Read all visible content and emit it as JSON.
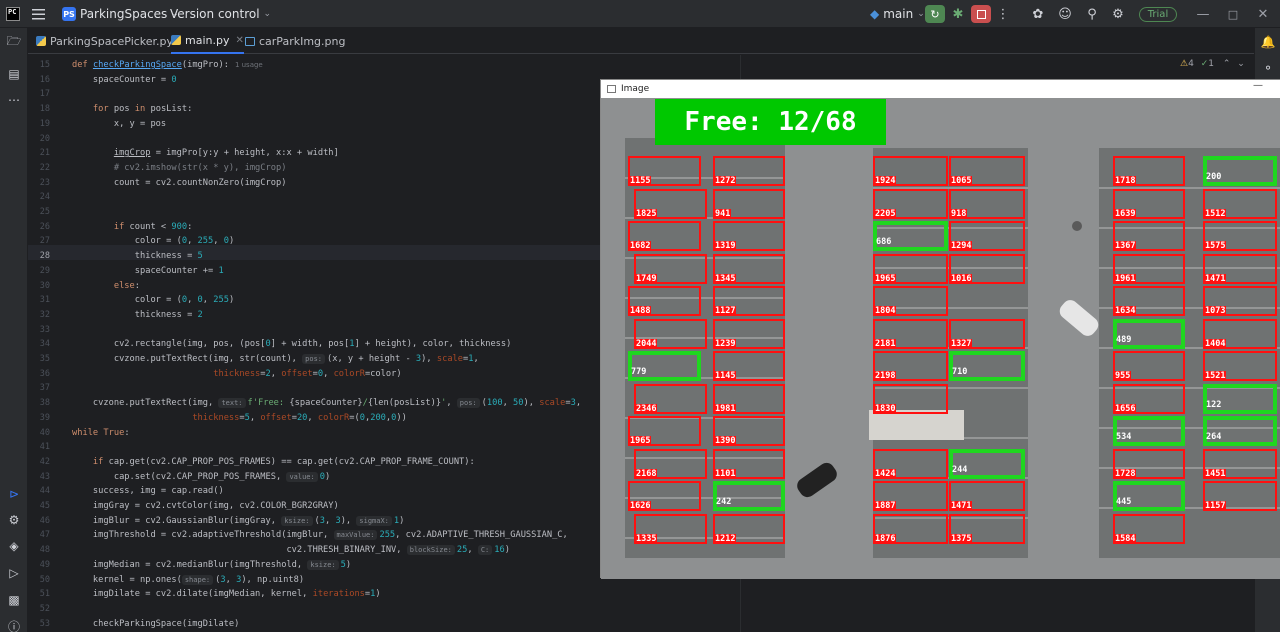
{
  "titlebar": {
    "project_badge": "PS",
    "project_name": "ParkingSpaces",
    "vcs_label": "Version control",
    "run_config": "main",
    "trial_label": "Trial"
  },
  "tabs": [
    {
      "label": "ParkingSpacePicker.py",
      "kind": "py"
    },
    {
      "label": "main.py",
      "kind": "py"
    },
    {
      "label": "carParkImg.png",
      "kind": "png"
    }
  ],
  "editor": {
    "current_line": 28,
    "warnings": "4",
    "weak_warnings": "1",
    "lines": [
      {
        "n": 15,
        "html": "<span class='kw'>def</span> <span class='fn'>checkParkingSpace</span>(imgPro):<span class='hint-usage'>1 usage</span>"
      },
      {
        "n": 16,
        "html": "    spaceCounter = <span class='num'>0</span>"
      },
      {
        "n": 17,
        "html": ""
      },
      {
        "n": 18,
        "html": "    <span class='kw'>for</span> pos <span class='kw'>in</span> posList:"
      },
      {
        "n": 19,
        "html": "        x, y = pos"
      },
      {
        "n": 20,
        "html": ""
      },
      {
        "n": 21,
        "html": "        <span style='text-decoration:underline'>imgCrop</span> = imgPro[y:y + height, x:x + width]"
      },
      {
        "n": 22,
        "html": "        <span class='cm'># cv2.imshow(str(x * y), imgCrop)</span>"
      },
      {
        "n": 23,
        "html": "        count = cv2.countNonZero(imgCrop)"
      },
      {
        "n": 24,
        "html": ""
      },
      {
        "n": 25,
        "html": ""
      },
      {
        "n": 26,
        "html": "        <span class='kw'>if</span> count &lt; <span class='num'>900</span>:"
      },
      {
        "n": 27,
        "html": "            color = (<span class='num'>0</span>, <span class='num'>255</span>, <span class='num'>0</span>)"
      },
      {
        "n": 28,
        "html": "            thickness = <span class='num'>5</span>"
      },
      {
        "n": 29,
        "html": "            spaceCounter += <span class='num'>1</span>"
      },
      {
        "n": 30,
        "html": "        <span class='kw'>else</span>:"
      },
      {
        "n": 31,
        "html": "            color = (<span class='num'>0</span>, <span class='num'>0</span>, <span class='num'>255</span>)"
      },
      {
        "n": 32,
        "html": "            thickness = <span class='num'>2</span>"
      },
      {
        "n": 33,
        "html": ""
      },
      {
        "n": 34,
        "html": "        cv2.rectangle(img, pos, (pos[<span class='num'>0</span>] + width, pos[<span class='num'>1</span>] + height), color, thickness)"
      },
      {
        "n": 35,
        "html": "        cvzone.putTextRect(img, str(count), <span class='hint'>pos:</span>(x, y + height - <span class='num'>3</span>), <span class='kwarg'>scale</span>=<span class='num'>1</span>,"
      },
      {
        "n": 36,
        "html": "                           <span class='kwarg'>thickness</span>=<span class='num'>2</span>, <span class='kwarg'>offset</span>=<span class='num'>0</span>, <span class='kwarg'>colorR</span>=color)"
      },
      {
        "n": 37,
        "html": ""
      },
      {
        "n": 38,
        "html": "    cvzone.putTextRect(img, <span class='hint'>text:</span><span class='str'>f'Free: </span>{spaceCounter}<span class='str'>/</span>{len(posList)}<span class='str'>'</span>, <span class='hint'>pos:</span>(<span class='num'>100</span>, <span class='num'>50</span>), <span class='kwarg'>scale</span>=<span class='num'>3</span>,"
      },
      {
        "n": 39,
        "html": "                       <span class='kwarg'>thickness</span>=<span class='num'>5</span>, <span class='kwarg'>offset</span>=<span class='num'>20</span>, <span class='kwarg'>colorR</span>=(<span class='num'>0</span>,<span class='num'>200</span>,<span class='num'>0</span>))"
      },
      {
        "n": 40,
        "html": "<span class='kw'>while</span> <span class='kw'>True</span>:"
      },
      {
        "n": 41,
        "html": ""
      },
      {
        "n": 42,
        "html": "    <span class='kw'>if</span> cap.get(cv2.CAP_PROP_POS_FRAMES) == cap.get(cv2.CAP_PROP_FRAME_COUNT):"
      },
      {
        "n": 43,
        "html": "        cap.set(cv2.CAP_PROP_POS_FRAMES, <span class='hint'>value:</span><span class='num'>0</span>)"
      },
      {
        "n": 44,
        "html": "    success, img = cap.read()"
      },
      {
        "n": 45,
        "html": "    imgGray = cv2.cvtColor(img, cv2.COLOR_BGR2GRAY)"
      },
      {
        "n": 46,
        "html": "    imgBlur = cv2.GaussianBlur(imgGray, <span class='hint'>ksize:</span>(<span class='num'>3</span>, <span class='num'>3</span>), <span class='hint'>sigmaX:</span><span class='num'>1</span>)"
      },
      {
        "n": 47,
        "html": "    imgThreshold = cv2.adaptiveThreshold(imgBlur, <span class='hint'>maxValue:</span><span class='num'>255</span>, cv2.ADAPTIVE_THRESH_GAUSSIAN_C,"
      },
      {
        "n": 48,
        "html": "                                         cv2.THRESH_BINARY_INV, <span class='hint'>blockSize:</span><span class='num'>25</span>, <span class='hint'>C:</span><span class='num'>16</span>)"
      },
      {
        "n": 49,
        "html": "    imgMedian = cv2.medianBlur(imgThreshold, <span class='hint'>ksize:</span><span class='num'>5</span>)"
      },
      {
        "n": 50,
        "html": "    kernel = np.ones(<span class='hint'>shape:</span>(<span class='num'>3</span>, <span class='num'>3</span>), np.uint8)"
      },
      {
        "n": 51,
        "html": "    imgDilate = cv2.dilate(imgMedian, kernel, <span class='kwarg'>iterations</span>=<span class='num'>1</span>)"
      },
      {
        "n": 52,
        "html": ""
      },
      {
        "n": 53,
        "html": "    checkParkingSpace(imgDilate)"
      }
    ]
  },
  "image_window": {
    "title": "Image",
    "free_text": "Free: 12/68",
    "colors": {
      "occupied": "#ff1010",
      "free": "#1fd61f",
      "banner": "#00c800"
    },
    "spaces": [
      {
        "label": "1155",
        "state": "occupied",
        "col": 0,
        "row": 0
      },
      {
        "label": "1825",
        "state": "occupied",
        "col": 0,
        "row": 1
      },
      {
        "label": "1682",
        "state": "occupied",
        "col": 0,
        "row": 2
      },
      {
        "label": "1749",
        "state": "occupied",
        "col": 0,
        "row": 3
      },
      {
        "label": "1488",
        "state": "occupied",
        "col": 0,
        "row": 4
      },
      {
        "label": "2044",
        "state": "occupied",
        "col": 0,
        "row": 5
      },
      {
        "label": "779",
        "state": "free",
        "col": 0,
        "row": 6
      },
      {
        "label": "2346",
        "state": "occupied",
        "col": 0,
        "row": 7
      },
      {
        "label": "1965",
        "state": "occupied",
        "col": 0,
        "row": 8
      },
      {
        "label": "2168",
        "state": "occupied",
        "col": 0,
        "row": 9
      },
      {
        "label": "1626",
        "state": "occupied",
        "col": 0,
        "row": 10
      },
      {
        "label": "1335",
        "state": "occupied",
        "col": 0,
        "row": 11
      },
      {
        "label": "1272",
        "state": "occupied",
        "col": 1,
        "row": 0
      },
      {
        "label": "941",
        "state": "occupied",
        "col": 1,
        "row": 1
      },
      {
        "label": "1319",
        "state": "occupied",
        "col": 1,
        "row": 2
      },
      {
        "label": "1345",
        "state": "occupied",
        "col": 1,
        "row": 3
      },
      {
        "label": "1127",
        "state": "occupied",
        "col": 1,
        "row": 4
      },
      {
        "label": "1239",
        "state": "occupied",
        "col": 1,
        "row": 5
      },
      {
        "label": "1145",
        "state": "occupied",
        "col": 1,
        "row": 6
      },
      {
        "label": "1981",
        "state": "occupied",
        "col": 1,
        "row": 7
      },
      {
        "label": "1390",
        "state": "occupied",
        "col": 1,
        "row": 8
      },
      {
        "label": "1101",
        "state": "occupied",
        "col": 1,
        "row": 9
      },
      {
        "label": "242",
        "state": "free",
        "col": 1,
        "row": 10
      },
      {
        "label": "1212",
        "state": "occupied",
        "col": 1,
        "row": 11
      },
      {
        "label": "1924",
        "state": "occupied",
        "col": 2,
        "row": 0
      },
      {
        "label": "2205",
        "state": "occupied",
        "col": 2,
        "row": 1
      },
      {
        "label": "686",
        "state": "free",
        "col": 2,
        "row": 2
      },
      {
        "label": "1965",
        "state": "occupied",
        "col": 2,
        "row": 3
      },
      {
        "label": "1804",
        "state": "occupied",
        "col": 2,
        "row": 4
      },
      {
        "label": "2181",
        "state": "occupied",
        "col": 2,
        "row": 5
      },
      {
        "label": "2198",
        "state": "occupied",
        "col": 2,
        "row": 6
      },
      {
        "label": "1830",
        "state": "occupied",
        "col": 2,
        "row": 7
      },
      {
        "label": "1424",
        "state": "occupied",
        "col": 2,
        "row": 9
      },
      {
        "label": "1887",
        "state": "occupied",
        "col": 2,
        "row": 10
      },
      {
        "label": "1876",
        "state": "occupied",
        "col": 2,
        "row": 11
      },
      {
        "label": "1065",
        "state": "occupied",
        "col": 3,
        "row": 0
      },
      {
        "label": "918",
        "state": "occupied",
        "col": 3,
        "row": 1
      },
      {
        "label": "1294",
        "state": "occupied",
        "col": 3,
        "row": 2
      },
      {
        "label": "1016",
        "state": "occupied",
        "col": 3,
        "row": 3
      },
      {
        "label": "1327",
        "state": "occupied",
        "col": 3,
        "row": 5
      },
      {
        "label": "710",
        "state": "free",
        "col": 3,
        "row": 6
      },
      {
        "label": "244",
        "state": "free",
        "col": 3,
        "row": 9
      },
      {
        "label": "1471",
        "state": "occupied",
        "col": 3,
        "row": 10
      },
      {
        "label": "1375",
        "state": "occupied",
        "col": 3,
        "row": 11
      },
      {
        "label": "1718",
        "state": "occupied",
        "col": 4,
        "row": 0
      },
      {
        "label": "1639",
        "state": "occupied",
        "col": 4,
        "row": 1
      },
      {
        "label": "1367",
        "state": "occupied",
        "col": 4,
        "row": 2
      },
      {
        "label": "1961",
        "state": "occupied",
        "col": 4,
        "row": 3
      },
      {
        "label": "1634",
        "state": "occupied",
        "col": 4,
        "row": 4
      },
      {
        "label": "489",
        "state": "free",
        "col": 4,
        "row": 5
      },
      {
        "label": "955",
        "state": "occupied",
        "col": 4,
        "row": 6
      },
      {
        "label": "1656",
        "state": "occupied",
        "col": 4,
        "row": 7
      },
      {
        "label": "534",
        "state": "free",
        "col": 4,
        "row": 8
      },
      {
        "label": "1728",
        "state": "occupied",
        "col": 4,
        "row": 9
      },
      {
        "label": "445",
        "state": "free",
        "col": 4,
        "row": 10
      },
      {
        "label": "1584",
        "state": "occupied",
        "col": 4,
        "row": 11
      },
      {
        "label": "200",
        "state": "free",
        "col": 5,
        "row": 0
      },
      {
        "label": "1512",
        "state": "occupied",
        "col": 5,
        "row": 1
      },
      {
        "label": "1575",
        "state": "occupied",
        "col": 5,
        "row": 2
      },
      {
        "label": "1471",
        "state": "occupied",
        "col": 5,
        "row": 3
      },
      {
        "label": "1073",
        "state": "occupied",
        "col": 5,
        "row": 4
      },
      {
        "label": "1404",
        "state": "occupied",
        "col": 5,
        "row": 5
      },
      {
        "label": "1521",
        "state": "occupied",
        "col": 5,
        "row": 6
      },
      {
        "label": "122",
        "state": "free",
        "col": 5,
        "row": 7
      },
      {
        "label": "264",
        "state": "free",
        "col": 5,
        "row": 8
      },
      {
        "label": "1451",
        "state": "occupied",
        "col": 5,
        "row": 9
      },
      {
        "label": "1157",
        "state": "occupied",
        "col": 5,
        "row": 10
      }
    ]
  }
}
